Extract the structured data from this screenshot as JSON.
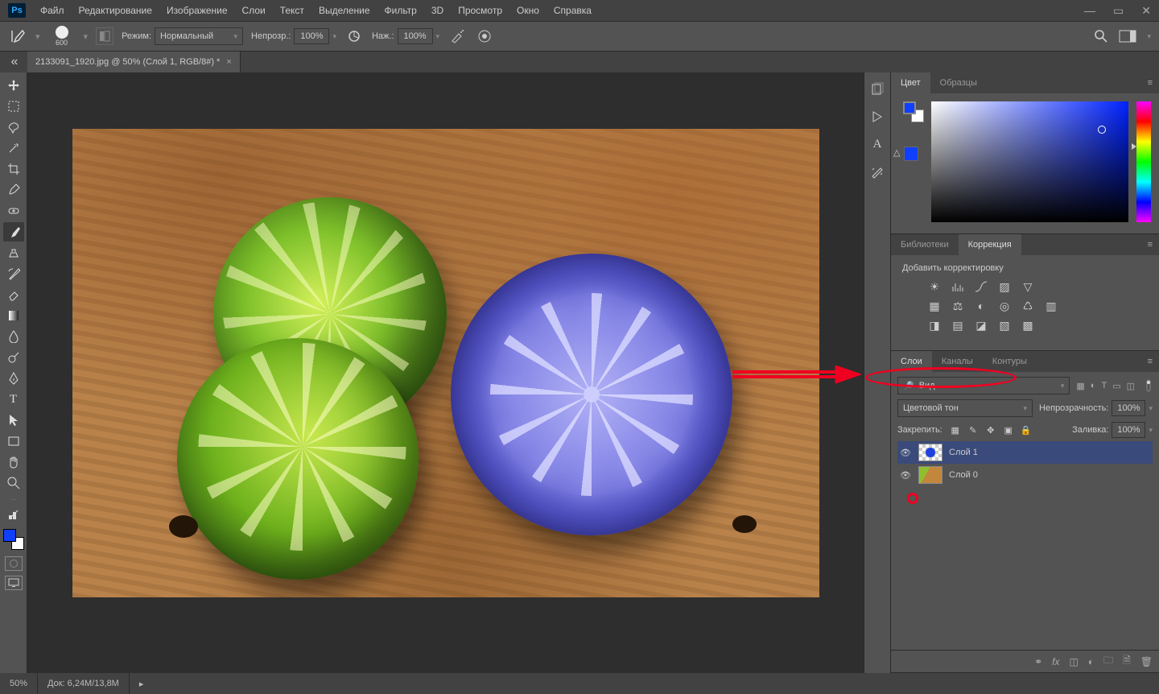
{
  "menu": {
    "items": [
      "Файл",
      "Редактирование",
      "Изображение",
      "Слои",
      "Текст",
      "Выделение",
      "Фильтр",
      "3D",
      "Просмотр",
      "Окно",
      "Справка"
    ]
  },
  "options": {
    "brush_size": "600",
    "mode_label": "Режим:",
    "mode_value": "Нормальный",
    "opacity_label": "Непрозр.:",
    "opacity_value": "100%",
    "flow_label": "Наж.:",
    "flow_value": "100%"
  },
  "tab": {
    "title": "2133091_1920.jpg @ 50% (Слой 1, RGB/8#) *"
  },
  "strip_icons": [
    "history-icon",
    "arrow-icon",
    "char-icon",
    "brush-settings-icon"
  ],
  "color_panel": {
    "tabs": [
      "Цвет",
      "Образцы"
    ]
  },
  "adjust_panel": {
    "tabs": [
      "Библиотеки",
      "Коррекция"
    ],
    "title": "Добавить корректировку"
  },
  "layers_panel": {
    "tabs": [
      "Слои",
      "Каналы",
      "Контуры"
    ],
    "kind_label": "Вид",
    "blend_value": "Цветовой тон",
    "opacity_label": "Непрозрачность:",
    "opacity_value": "100%",
    "lock_label": "Закрепить:",
    "fill_label": "Заливка:",
    "fill_value": "100%",
    "layers": [
      {
        "name": "Слой 1"
      },
      {
        "name": "Слой 0"
      }
    ]
  },
  "status": {
    "zoom": "50%",
    "doc": "Док: 6,24M/13,8M"
  }
}
